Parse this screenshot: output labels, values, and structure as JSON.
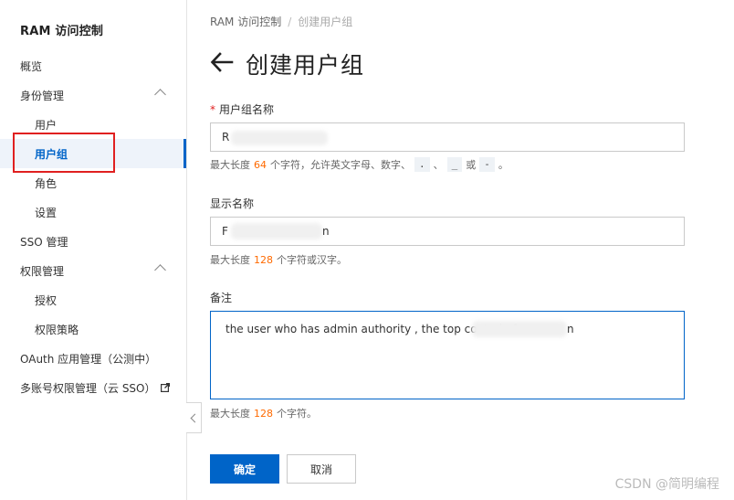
{
  "sidebar": {
    "title": "RAM 访问控制",
    "items": [
      {
        "label": "概览"
      },
      {
        "label": "身份管理"
      },
      {
        "label": "用户"
      },
      {
        "label": "用户组"
      },
      {
        "label": "角色"
      },
      {
        "label": "设置"
      },
      {
        "label": "SSO 管理"
      },
      {
        "label": "权限管理"
      },
      {
        "label": "授权"
      },
      {
        "label": "权限策略"
      },
      {
        "label": "OAuth 应用管理（公测中）"
      },
      {
        "label": "多账号权限管理（云 SSO）"
      }
    ]
  },
  "breadcrumb": {
    "root": "RAM 访问控制",
    "separator": "/",
    "current": "创建用户组"
  },
  "page": {
    "title": "创建用户组"
  },
  "form": {
    "group_name": {
      "required_mark": "*",
      "label": "用户组名称",
      "value": "R",
      "hint_prefix": "最大长度",
      "hint_num": "64",
      "hint_mid": "个字符，允许英文字母、数字、",
      "hint_code1": ".",
      "hint_sep1": "、",
      "hint_code2": "_",
      "hint_or": "或",
      "hint_code3": "-",
      "hint_end": "。"
    },
    "display_name": {
      "label": "显示名称",
      "value": "F",
      "value_tail": "n",
      "hint_prefix": "最大长度",
      "hint_num": "128",
      "hint_suffix": "个字符或汉字。"
    },
    "remark": {
      "label": "备注",
      "value": "the user who has admin authority , the top control of",
      "value_tail": "n",
      "hint_prefix": "最大长度",
      "hint_num": "128",
      "hint_suffix": "个字符。"
    }
  },
  "buttons": {
    "ok": "确定",
    "cancel": "取消"
  },
  "watermark": "CSDN @简明编程",
  "colors": {
    "accent": "#0064c8",
    "highlight": "#ff6a00",
    "annotation_red": "#e02020"
  }
}
